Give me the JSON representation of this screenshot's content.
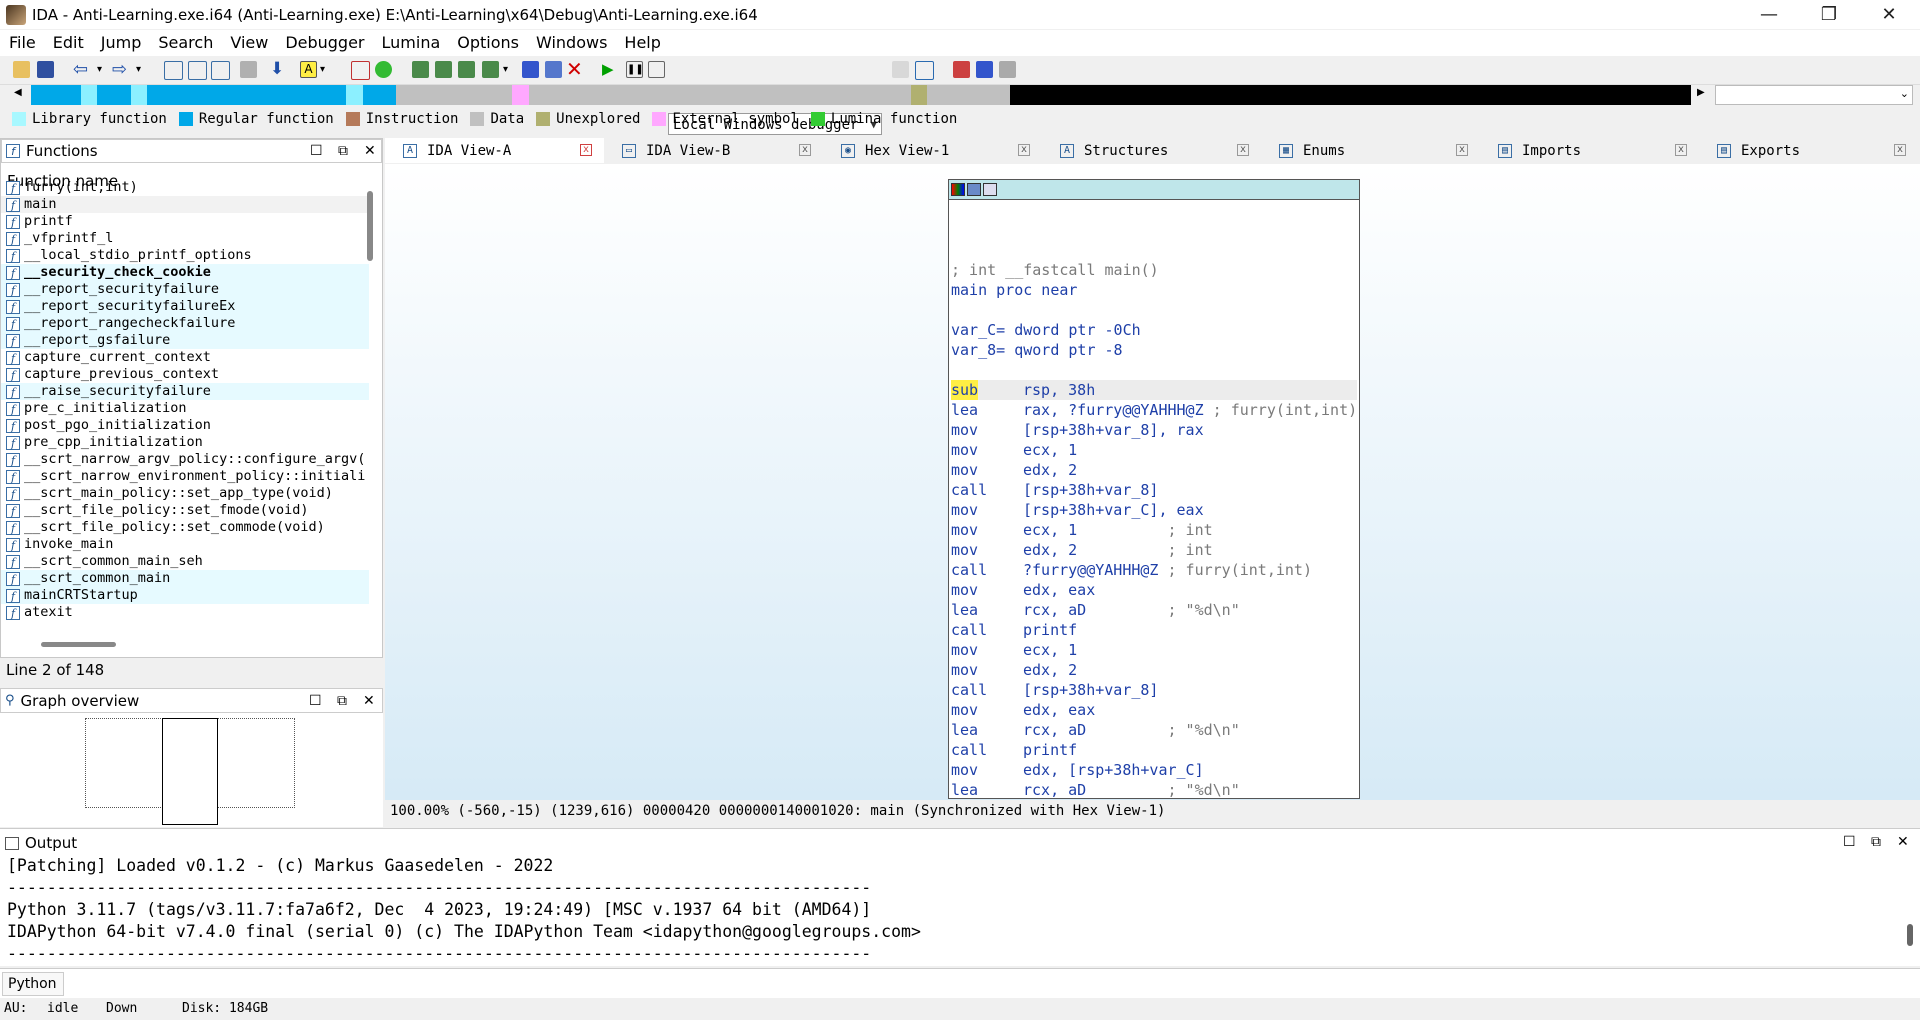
{
  "window": {
    "title": "IDA - Anti-Learning.exe.i64 (Anti-Learning.exe) E:\\Anti-Learning\\x64\\Debug\\Anti-Learning.exe.i64",
    "controls": [
      "—",
      "❐",
      "✕"
    ]
  },
  "menu": [
    "File",
    "Edit",
    "Jump",
    "Search",
    "View",
    "Debugger",
    "Lumina",
    "Options",
    "Windows",
    "Help"
  ],
  "toolbar": {
    "debugger": "Local Windows debugger"
  },
  "navband": {
    "segments": [
      {
        "color": "#00a8e8",
        "w": 3
      },
      {
        "color": "#8cf0ff",
        "w": 1
      },
      {
        "color": "#00a8e8",
        "w": 2
      },
      {
        "color": "#8cf0ff",
        "w": 1
      },
      {
        "color": "#00a8e8",
        "w": 12
      },
      {
        "color": "#8cf0ff",
        "w": 1
      },
      {
        "color": "#00a8e8",
        "w": 2
      },
      {
        "color": "#c0c0c0",
        "w": 7
      },
      {
        "color": "#ffa8ff",
        "w": 1
      },
      {
        "color": "#c0c0c0",
        "w": 23
      },
      {
        "color": "#b0b070",
        "w": 1
      },
      {
        "color": "#c0c0c0",
        "w": 5
      },
      {
        "color": "#000000",
        "w": 41
      }
    ]
  },
  "legend": [
    {
      "label": "Library function",
      "color": "#a8f8ff"
    },
    {
      "label": "Regular function",
      "color": "#00a8e8"
    },
    {
      "label": "Instruction",
      "color": "#b57a5a"
    },
    {
      "label": "Data",
      "color": "#c0c0c0"
    },
    {
      "label": "Unexplored",
      "color": "#b0b070"
    },
    {
      "label": "External symbol",
      "color": "#ffa8ff"
    },
    {
      "label": "Lumina function",
      "color": "#33cc33"
    }
  ],
  "functions_pane": {
    "title": "Functions",
    "column": "Function name",
    "status": "Line 2 of 148",
    "items": [
      {
        "name": "furry(int,int)",
        "bold": false,
        "hl": false
      },
      {
        "name": "main",
        "bold": false,
        "hl": false,
        "sel": true
      },
      {
        "name": "printf",
        "bold": false,
        "hl": false
      },
      {
        "name": "_vfprintf_l",
        "bold": false,
        "hl": false
      },
      {
        "name": "__local_stdio_printf_options",
        "bold": false,
        "hl": false
      },
      {
        "name": "__security_check_cookie",
        "bold": true,
        "hl": true
      },
      {
        "name": "__report_securityfailure",
        "bold": false,
        "hl": true
      },
      {
        "name": "__report_securityfailureEx",
        "bold": false,
        "hl": true
      },
      {
        "name": "__report_rangecheckfailure",
        "bold": false,
        "hl": true
      },
      {
        "name": "__report_gsfailure",
        "bold": false,
        "hl": true
      },
      {
        "name": "capture_current_context",
        "bold": false,
        "hl": false
      },
      {
        "name": "capture_previous_context",
        "bold": false,
        "hl": false
      },
      {
        "name": "__raise_securityfailure",
        "bold": false,
        "hl": true
      },
      {
        "name": "pre_c_initialization",
        "bold": false,
        "hl": false
      },
      {
        "name": "post_pgo_initialization",
        "bold": false,
        "hl": false
      },
      {
        "name": "pre_cpp_initialization",
        "bold": false,
        "hl": false
      },
      {
        "name": "__scrt_narrow_argv_policy::configure_argv(",
        "bold": false,
        "hl": false
      },
      {
        "name": "__scrt_narrow_environment_policy::initiali",
        "bold": false,
        "hl": false
      },
      {
        "name": "__scrt_main_policy::set_app_type(void)",
        "bold": false,
        "hl": false
      },
      {
        "name": "__scrt_file_policy::set_fmode(void)",
        "bold": false,
        "hl": false
      },
      {
        "name": "__scrt_file_policy::set_commode(void)",
        "bold": false,
        "hl": false
      },
      {
        "name": "invoke_main",
        "bold": false,
        "hl": false
      },
      {
        "name": "__scrt_common_main_seh",
        "bold": false,
        "hl": false
      },
      {
        "name": "__scrt_common_main",
        "bold": false,
        "hl": true
      },
      {
        "name": "mainCRTStartup",
        "bold": false,
        "hl": true
      },
      {
        "name": "atexit",
        "bold": false,
        "hl": false
      }
    ]
  },
  "graph_overview": {
    "title": "Graph overview"
  },
  "tabs": [
    {
      "label": "IDA View-A",
      "icon": "A",
      "close": "x",
      "active": true
    },
    {
      "label": "IDA View-B",
      "icon": "▭",
      "close": "x",
      "active": false
    },
    {
      "label": "Hex View-1",
      "icon": "◉",
      "close": "x",
      "active": false
    },
    {
      "label": "Structures",
      "icon": "A",
      "close": "x",
      "active": false
    },
    {
      "label": "Enums",
      "icon": "▦",
      "close": "x",
      "active": false
    },
    {
      "label": "Imports",
      "icon": "▤",
      "close": "x",
      "active": false
    },
    {
      "label": "Exports",
      "icon": "▤",
      "close": "x",
      "active": false
    }
  ],
  "asm": [
    {
      "mn": "",
      "ops": "",
      "cm": "; int __fastcall main()",
      "kind": "comment"
    },
    {
      "mn": "main proc near",
      "ops": "",
      "cm": "",
      "kind": "label"
    },
    {
      "mn": "",
      "ops": "",
      "cm": "",
      "kind": "blank"
    },
    {
      "mn": "var_C= dword ptr -0Ch",
      "ops": "",
      "cm": "",
      "kind": "label"
    },
    {
      "mn": "var_8= qword ptr -8",
      "ops": "",
      "cm": "",
      "kind": "label"
    },
    {
      "mn": "",
      "ops": "",
      "cm": "",
      "kind": "blank"
    },
    {
      "mn": "sub",
      "ops": "rsp, 38h",
      "cm": "",
      "kind": "insn",
      "sel": true
    },
    {
      "mn": "lea",
      "ops": "rax, ?furry@@YAHHH@Z",
      "cm": " ; furry(int,int)",
      "kind": "insn"
    },
    {
      "mn": "mov",
      "ops": "[rsp+38h+var_8], rax",
      "cm": "",
      "kind": "insn"
    },
    {
      "mn": "mov",
      "ops": "ecx, 1",
      "cm": "",
      "kind": "insn"
    },
    {
      "mn": "mov",
      "ops": "edx, 2",
      "cm": "",
      "kind": "insn"
    },
    {
      "mn": "call",
      "ops": "[rsp+38h+var_8]",
      "cm": "",
      "kind": "insn"
    },
    {
      "mn": "mov",
      "ops": "[rsp+38h+var_C], eax",
      "cm": "",
      "kind": "insn"
    },
    {
      "mn": "mov",
      "ops": "ecx, 1          ",
      "cm": "; int",
      "kind": "insn"
    },
    {
      "mn": "mov",
      "ops": "edx, 2          ",
      "cm": "; int",
      "kind": "insn"
    },
    {
      "mn": "call",
      "ops": "?furry@@YAHHH@Z",
      "cm": " ; furry(int,int)",
      "kind": "insn"
    },
    {
      "mn": "mov",
      "ops": "edx, eax",
      "cm": "",
      "kind": "insn"
    },
    {
      "mn": "lea",
      "ops": "rcx, aD         ",
      "cm": "; \"%d\\n\"",
      "kind": "insn"
    },
    {
      "mn": "call",
      "ops": "printf",
      "cm": "",
      "kind": "insn"
    },
    {
      "mn": "mov",
      "ops": "ecx, 1",
      "cm": "",
      "kind": "insn"
    },
    {
      "mn": "mov",
      "ops": "edx, 2",
      "cm": "",
      "kind": "insn"
    },
    {
      "mn": "call",
      "ops": "[rsp+38h+var_8]",
      "cm": "",
      "kind": "insn"
    },
    {
      "mn": "mov",
      "ops": "edx, eax",
      "cm": "",
      "kind": "insn"
    },
    {
      "mn": "lea",
      "ops": "rcx, aD         ",
      "cm": "; \"%d\\n\"",
      "kind": "insn"
    },
    {
      "mn": "call",
      "ops": "printf",
      "cm": "",
      "kind": "insn"
    },
    {
      "mn": "mov",
      "ops": "edx, [rsp+38h+var_C]",
      "cm": "",
      "kind": "insn"
    },
    {
      "mn": "lea",
      "ops": "rcx, aD         ",
      "cm": "; \"%d\\n\"",
      "kind": "insn"
    }
  ],
  "view_status": "100.00% (-560,-15) (1239,616) 00000420 0000000140001020: main (Synchronized with Hex View-1)",
  "output": {
    "title": "Output",
    "lines": [
      "[Patching] Loaded v0.1.2 - (c) Markus Gaasedelen - 2022",
      "---------------------------------------------------------------------------------------",
      "Python 3.11.7 (tags/v3.11.7:fa7a6f2, Dec  4 2023, 19:24:49) [MSC v.1937 64 bit (AMD64)]",
      "IDAPython 64-bit v7.4.0 final (serial 0) (c) The IDAPython Team <idapython@googlegroups.com>",
      "---------------------------------------------------------------------------------------"
    ],
    "cli_button": "Python"
  },
  "status_bar": {
    "au_label": "AU:",
    "au_value": "idle",
    "direction": "Down",
    "disk": "Disk: 184GB"
  }
}
